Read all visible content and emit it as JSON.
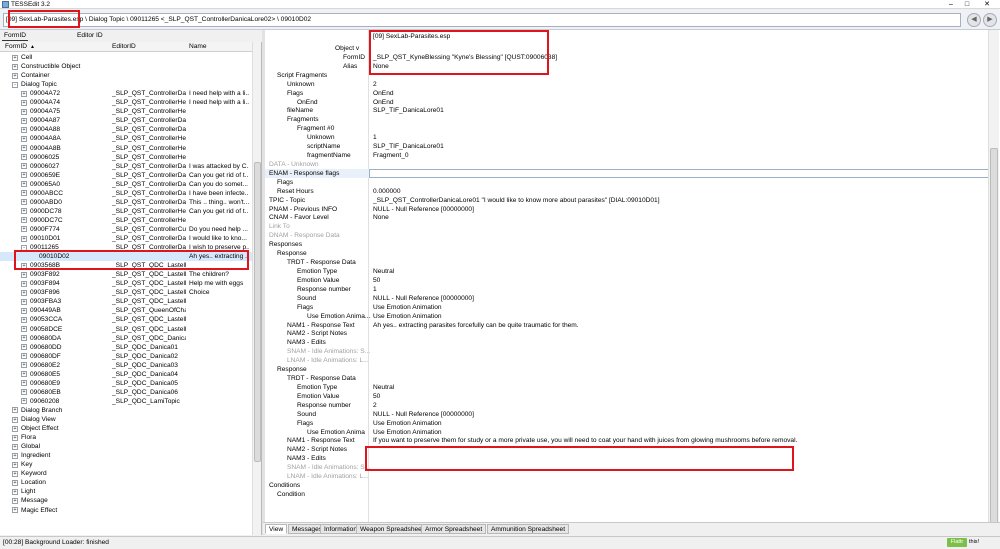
{
  "window": {
    "title": "TESSEdit 3.2"
  },
  "pathbar": {
    "path": "[09] SexLab-Parasites.esp \\ Dialog Topic \\ 09011265 <_SLP_QST_ControllerDanicaLore02> \\ 09010D02"
  },
  "left_tabs": [
    "FormID",
    "Editor ID"
  ],
  "columns": [
    "FormID",
    "EditorID",
    "Name"
  ],
  "tree": [
    {
      "exp": "+",
      "indent": 1,
      "id": "Cell",
      "editor": "",
      "name": ""
    },
    {
      "exp": "+",
      "indent": 1,
      "id": "Constructible Object",
      "editor": "",
      "name": ""
    },
    {
      "exp": "+",
      "indent": 1,
      "id": "Container",
      "editor": "",
      "name": ""
    },
    {
      "exp": "-",
      "indent": 1,
      "id": "Dialog Topic",
      "editor": "",
      "name": ""
    },
    {
      "exp": "+",
      "indent": 2,
      "id": "09004A72",
      "editor": "_SLP_QST_ControllerDa...",
      "name": "I need help with a li..."
    },
    {
      "exp": "+",
      "indent": 2,
      "id": "09004A74",
      "editor": "_SLP_QST_ControllerHe...",
      "name": "I need help with a li..."
    },
    {
      "exp": "+",
      "indent": 2,
      "id": "09004A75",
      "editor": "_SLP_QST_ControllerHello",
      "name": ""
    },
    {
      "exp": "+",
      "indent": 2,
      "id": "09004A87",
      "editor": "_SLP_QST_ControllerDanicaCureSpiderEgg",
      "name": ""
    },
    {
      "exp": "+",
      "indent": 2,
      "id": "09004A88",
      "editor": "_SLP_QST_ControllerDanicaCureSpiderPenis",
      "name": ""
    },
    {
      "exp": "+",
      "indent": 2,
      "id": "09004A8A",
      "editor": "_SLP_QST_ControllerHealersCureSpiderEgg",
      "name": ""
    },
    {
      "exp": "+",
      "indent": 2,
      "id": "09004A8B",
      "editor": "_SLP_QST_ControllerHealersCureSpiderPenis",
      "name": ""
    },
    {
      "exp": "+",
      "indent": 2,
      "id": "09006025",
      "editor": "_SLP_QST_ControllerHealersCureChaurusEgg",
      "name": ""
    },
    {
      "exp": "+",
      "indent": 2,
      "id": "09006027",
      "editor": "_SLP_QST_ControllerDa...",
      "name": "I was attacked by C..."
    },
    {
      "exp": "+",
      "indent": 2,
      "id": "0900659E",
      "editor": "_SLP_QST_ControllerDa...",
      "name": "Can you get rid of t..."
    },
    {
      "exp": "+",
      "indent": 2,
      "id": "090065A0",
      "editor": "_SLP_QST_ControllerDa...",
      "name": "Can you do somet..."
    },
    {
      "exp": "+",
      "indent": 2,
      "id": "0900ABCC",
      "editor": "_SLP_QST_ControllerDa...",
      "name": "I have been infecte..."
    },
    {
      "exp": "+",
      "indent": 2,
      "id": "0900ABD0",
      "editor": "_SLP_QST_ControllerDa...",
      "name": "This .. thing.. won't..."
    },
    {
      "exp": "+",
      "indent": 2,
      "id": "0900DC78",
      "editor": "_SLP_QST_ControllerHe...",
      "name": "Can you get rid of t..."
    },
    {
      "exp": "+",
      "indent": 2,
      "id": "0900DC7C",
      "editor": "_SLP_QST_ControllerHealersCureBarnacles",
      "name": ""
    },
    {
      "exp": "+",
      "indent": 2,
      "id": "0900F774",
      "editor": "_SLP_QST_ControllerCu...",
      "name": "Do you need help ..."
    },
    {
      "exp": "+",
      "indent": 2,
      "id": "09010D01",
      "editor": "_SLP_QST_ControllerDa...",
      "name": "I would like to kno..."
    },
    {
      "exp": "-",
      "indent": 2,
      "id": "09011265",
      "editor": "_SLP_QST_ControllerDa...",
      "name": "I wish to preserve p..."
    },
    {
      "exp": "",
      "indent": 3,
      "id": "09010D02",
      "editor": "",
      "name": "Ah yes.. extracting ...",
      "selected": true
    },
    {
      "exp": "+",
      "indent": 2,
      "id": "0903568B",
      "editor": "_SLP_QST_QDC_LastelleHello",
      "name": ""
    },
    {
      "exp": "+",
      "indent": 2,
      "id": "0903F892",
      "editor": "_SLP_QST_QDC_LastelleDa...",
      "name": "The children?"
    },
    {
      "exp": "+",
      "indent": 2,
      "id": "0903F894",
      "editor": "_SLP_QST_QDC_LastelleDa...",
      "name": "Help me with eggs"
    },
    {
      "exp": "+",
      "indent": 2,
      "id": "0903F896",
      "editor": "_SLP_QST_QDC_LastelleDa...",
      "name": "Choice"
    },
    {
      "exp": "+",
      "indent": 2,
      "id": "0903FBA3",
      "editor": "_SLP_QST_QDC_LastelleTasksTopic",
      "name": ""
    },
    {
      "exp": "+",
      "indent": 2,
      "id": "090449AB",
      "editor": "_SLP_QST_QueenOfChaurusHello",
      "name": ""
    },
    {
      "exp": "+",
      "indent": 2,
      "id": "09053CCA",
      "editor": "_SLP_QST_QDC_LastelleRepeatTaskTopic",
      "name": ""
    },
    {
      "exp": "+",
      "indent": 2,
      "id": "09058DCE",
      "editor": "_SLP_QST_QDC_LastelleIntro03",
      "name": ""
    },
    {
      "exp": "+",
      "indent": 2,
      "id": "090680DA",
      "editor": "_SLP_QST_QDC_DanicaTasksTopic",
      "name": ""
    },
    {
      "exp": "+",
      "indent": 2,
      "id": "090680DD",
      "editor": "_SLP_QDC_Danica01",
      "name": ""
    },
    {
      "exp": "+",
      "indent": 2,
      "id": "090680DF",
      "editor": "_SLP_QDC_Danica02",
      "name": ""
    },
    {
      "exp": "+",
      "indent": 2,
      "id": "090680E2",
      "editor": "_SLP_QDC_Danica03",
      "name": ""
    },
    {
      "exp": "+",
      "indent": 2,
      "id": "090680E5",
      "editor": "_SLP_QDC_Danica04",
      "name": ""
    },
    {
      "exp": "+",
      "indent": 2,
      "id": "090680E9",
      "editor": "_SLP_QDC_Danica05",
      "name": ""
    },
    {
      "exp": "+",
      "indent": 2,
      "id": "090680EB",
      "editor": "_SLP_QDC_Danica06",
      "name": ""
    },
    {
      "exp": "+",
      "indent": 2,
      "id": "09060208",
      "editor": "_SLP_QDC_LamiTopic",
      "name": ""
    },
    {
      "exp": "+",
      "indent": 1,
      "id": "Dialog Branch",
      "editor": "",
      "name": ""
    },
    {
      "exp": "+",
      "indent": 1,
      "id": "Dialog View",
      "editor": "",
      "name": ""
    },
    {
      "exp": "+",
      "indent": 1,
      "id": "Object Effect",
      "editor": "",
      "name": ""
    },
    {
      "exp": "+",
      "indent": 1,
      "id": "Flora",
      "editor": "",
      "name": ""
    },
    {
      "exp": "+",
      "indent": 1,
      "id": "Global",
      "editor": "",
      "name": ""
    },
    {
      "exp": "+",
      "indent": 1,
      "id": "Ingredient",
      "editor": "",
      "name": ""
    },
    {
      "exp": "+",
      "indent": 1,
      "id": "Key",
      "editor": "",
      "name": ""
    },
    {
      "exp": "+",
      "indent": 1,
      "id": "Keyword",
      "editor": "",
      "name": ""
    },
    {
      "exp": "+",
      "indent": 1,
      "id": "Location",
      "editor": "",
      "name": ""
    },
    {
      "exp": "+",
      "indent": 1,
      "id": "Light",
      "editor": "",
      "name": ""
    },
    {
      "exp": "+",
      "indent": 1,
      "id": "Message",
      "editor": "",
      "name": ""
    },
    {
      "exp": "+",
      "indent": 1,
      "id": "Magic Effect",
      "editor": "",
      "name": ""
    }
  ],
  "record_header": "[09] SexLab-Parasites.esp",
  "record_rows": [
    {
      "label": "Object v",
      "value": "",
      "indent": 70
    },
    {
      "label": "FormID",
      "value": "_SLP_QST_KyneBlessing \"Kyne's Blessing\" [QUST:09006038]",
      "indent": 78
    },
    {
      "label": "Alias",
      "value": "None",
      "indent": 78
    },
    {
      "label": "Script Fragments",
      "value": "",
      "indent": 12
    },
    {
      "label": "Unknown",
      "value": "2",
      "indent": 22
    },
    {
      "label": "Flags",
      "value": "OnEnd",
      "indent": 22
    },
    {
      "label": "OnEnd",
      "value": "OnEnd",
      "indent": 32
    },
    {
      "label": "fileName",
      "value": "SLP_TIF_DanicaLore01",
      "indent": 22
    },
    {
      "label": "Fragments",
      "value": "",
      "indent": 22
    },
    {
      "label": "Fragment #0",
      "value": "",
      "indent": 32
    },
    {
      "label": "Unknown",
      "value": "1",
      "indent": 42
    },
    {
      "label": "scriptName",
      "value": "SLP_TIF_DanicaLore01",
      "indent": 42
    },
    {
      "label": "fragmentName",
      "value": "Fragment_0",
      "indent": 42
    },
    {
      "label": "DATA - Unknown",
      "value": "",
      "indent": 4,
      "gray": true
    },
    {
      "label": "ENAM - Response flags",
      "value": "",
      "indent": 4,
      "hl": true
    },
    {
      "label": "Flags",
      "value": "",
      "indent": 12
    },
    {
      "label": "Reset Hours",
      "value": "0.000000",
      "indent": 12
    },
    {
      "label": "TPIC - Topic",
      "value": "_SLP_QST_ControllerDanicaLore01 \"I would like to know more about parasites\" [DIAL:09010D01]",
      "indent": 4
    },
    {
      "label": "PNAM - Previous INFO",
      "value": "NULL - Null Reference [00000000]",
      "indent": 4
    },
    {
      "label": "CNAM - Favor Level",
      "value": "None",
      "indent": 4
    },
    {
      "label": "Link To",
      "value": "",
      "indent": 4,
      "gray": true
    },
    {
      "label": "DNAM - Response Data",
      "value": "",
      "indent": 4,
      "gray": true
    },
    {
      "label": "Responses",
      "value": "",
      "indent": 4
    },
    {
      "label": "Response",
      "value": "",
      "indent": 12
    },
    {
      "label": "TRDT - Response Data",
      "value": "",
      "indent": 22
    },
    {
      "label": "Emotion Type",
      "value": "Neutral",
      "indent": 32
    },
    {
      "label": "Emotion Value",
      "value": "50",
      "indent": 32
    },
    {
      "label": "Response number",
      "value": "1",
      "indent": 32
    },
    {
      "label": "Sound",
      "value": "NULL - Null Reference [00000000]",
      "indent": 32
    },
    {
      "label": "Flags",
      "value": "Use Emotion Animation",
      "indent": 32
    },
    {
      "label": "Use Emotion Anima...",
      "value": "Use Emotion Animation",
      "indent": 42
    },
    {
      "label": "NAM1 - Response Text",
      "value": "Ah yes.. extracting parasites forcefully can be quite traumatic for them.",
      "indent": 22
    },
    {
      "label": "NAM2 - Script Notes",
      "value": "",
      "indent": 22
    },
    {
      "label": "NAM3 - Edits",
      "value": "",
      "indent": 22
    },
    {
      "label": "SNAM - Idle Animations: S...",
      "value": "",
      "indent": 22,
      "gray": true
    },
    {
      "label": "LNAM - Idle Animations: L...",
      "value": "",
      "indent": 22,
      "gray": true
    },
    {
      "label": "Response",
      "value": "",
      "indent": 12
    },
    {
      "label": "TRDT - Response Data",
      "value": "",
      "indent": 22
    },
    {
      "label": "Emotion Type",
      "value": "Neutral",
      "indent": 32
    },
    {
      "label": "Emotion Value",
      "value": "50",
      "indent": 32
    },
    {
      "label": "Response number",
      "value": "2",
      "indent": 32
    },
    {
      "label": "Sound",
      "value": "NULL - Null Reference [00000000]",
      "indent": 32
    },
    {
      "label": "Flags",
      "value": "Use Emotion Animation",
      "indent": 32
    },
    {
      "label": "Use Emotion Anima",
      "value": "Use Emotion Animation",
      "indent": 42
    },
    {
      "label": "NAM1 - Response Text",
      "value": "If you want to preserve them for study or a more private use, you will need to coat your hand with juices from glowing mushrooms before removal.",
      "indent": 22
    },
    {
      "label": "NAM2 - Script Notes",
      "value": "",
      "indent": 22
    },
    {
      "label": "NAM3 - Edits",
      "value": "",
      "indent": 22
    },
    {
      "label": "SNAM - Idle Animations: S...",
      "value": "",
      "indent": 22,
      "gray": true
    },
    {
      "label": "LNAM - Idle Animations: L...",
      "value": "",
      "indent": 22,
      "gray": true
    },
    {
      "label": "Conditions",
      "value": "",
      "indent": 4
    },
    {
      "label": "Condition",
      "value": "",
      "indent": 12
    }
  ],
  "bottom_tabs": [
    "View",
    "Messages",
    "Information",
    "Weapon Spreadsheet",
    "Armor Spreadsheet",
    "Ammunition Spreadsheet"
  ],
  "status": "[00:28] Background Loader: finished",
  "flattr": {
    "label": "Flattr",
    "this": "this!"
  },
  "colors": {
    "highlight_box": "#e0141c",
    "selection": "#d6e8fb"
  }
}
